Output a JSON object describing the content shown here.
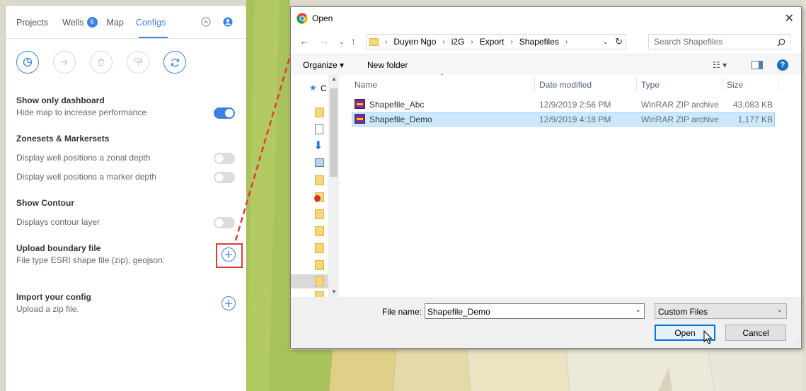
{
  "panel": {
    "tabs": [
      {
        "label": "Projects"
      },
      {
        "label": "Wells",
        "badge": "5"
      },
      {
        "label": "Map"
      },
      {
        "label": "Configs"
      }
    ],
    "header_icons": [
      "chevron-up-circle-icon",
      "user-circle-icon"
    ],
    "tool_icons": [
      "pie-chart-icon",
      "arrow-right-icon",
      "trash-icon",
      "paint-roller-icon",
      "refresh-icon"
    ],
    "show_dashboard": {
      "title": "Show only dashboard",
      "desc": "Hide map to increase performance",
      "enabled": true
    },
    "zonesets": {
      "title": "Zonesets & Markersets",
      "zonal_desc": "Display well positions a zonal depth",
      "marker_desc": "Display well positions a marker depth",
      "zonal_enabled": false,
      "marker_enabled": false
    },
    "contour": {
      "title": "Show Contour",
      "desc": "Displays contour layer",
      "enabled": false
    },
    "upload": {
      "title": "Upload boundary file",
      "desc": "File type ESRI shape file (zip), geojson."
    },
    "import": {
      "title": "Import your config",
      "desc": "Upload a zip file."
    }
  },
  "dialog": {
    "title": "Open",
    "breadcrumbs": [
      "Duyen Ngo",
      "i2G",
      "Export",
      "Shapefiles"
    ],
    "search_placeholder": "Search Shapefiles",
    "organize": "Organize ▾",
    "new_folder": "New folder",
    "nav_label": "C",
    "columns": {
      "name": "Name",
      "date": "Date modified",
      "type": "Type",
      "size": "Size"
    },
    "files": [
      {
        "name": "Shapefile_Abc",
        "date": "12/9/2019 2:56 PM",
        "type": "WinRAR ZIP archive",
        "size": "43,083 KB",
        "selected": false
      },
      {
        "name": "Shapefile_Demo",
        "date": "12/9/2019 4:18 PM",
        "type": "WinRAR ZIP archive",
        "size": "1,177 KB",
        "selected": true
      }
    ],
    "file_name_label": "File name:",
    "file_name_value": "Shapefile_Demo",
    "filter_value": "Custom Files",
    "open_label": "Open",
    "cancel_label": "Cancel"
  },
  "colors": {
    "accent": "#3b82e0",
    "highlight": "#e23a3a",
    "map_green": "#a8c25a"
  }
}
